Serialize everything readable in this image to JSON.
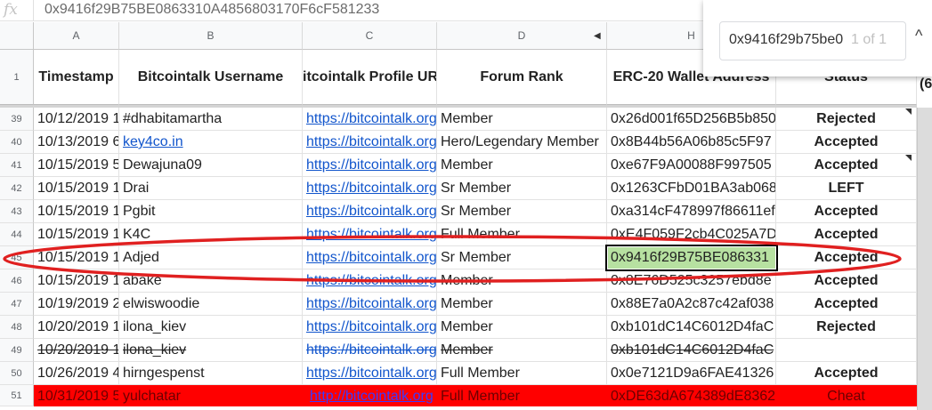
{
  "formula_bar": {
    "fx_label": "fx",
    "content": "0x9416f29B75BE0863310A4856803170F6cF581233"
  },
  "columns": [
    {
      "letter": "A"
    },
    {
      "letter": "B"
    },
    {
      "letter": "C"
    },
    {
      "letter": "D"
    },
    {
      "letter": "H"
    }
  ],
  "header_row": {
    "number": "1",
    "timestamp": "Timestamp",
    "username": "Bitcointalk Username",
    "profile_url": "itcointalk Profile UR",
    "forum_rank": "Forum Rank",
    "wallet": "ERC-20 Wallet Address",
    "status": "Status",
    "extra": "(6"
  },
  "rows": [
    {
      "num": "39",
      "ts": "10/12/2019 1",
      "user": "#dhabitamartha",
      "url": "https://bitcointalk.org",
      "rank": "Member",
      "wallet": "0x26d001f65D256B5b850",
      "status": "Rejected"
    },
    {
      "num": "40",
      "ts": "10/13/2019 6",
      "user": "key4co.in",
      "url": "https://bitcointalk.org",
      "rank": "Hero/Legendary Member",
      "wallet": "0x8B44b56A06b85c5F97",
      "status": "Accepted"
    },
    {
      "num": "41",
      "ts": "10/15/2019 5",
      "user": "Dewajuna09",
      "url": "https://bitcointalk.org",
      "rank": "Member",
      "wallet": "0xe67F9A00088F997505",
      "status": "Accepted"
    },
    {
      "num": "42",
      "ts": "10/15/2019 1",
      "user": "Drai",
      "url": "https://bitcointalk.org",
      "rank": "Sr Member",
      "wallet": "0x1263CFbD01BA3ab068",
      "status": "LEFT"
    },
    {
      "num": "43",
      "ts": "10/15/2019 1",
      "user": "Pgbit",
      "url": "https://bitcointalk.org",
      "rank": "Sr Member",
      "wallet": "0xa314cF478997f86611ef",
      "status": "Accepted"
    },
    {
      "num": "44",
      "ts": "10/15/2019 1",
      "user": "K4C",
      "url": "https://bitcointalk.org",
      "rank": "Full Member",
      "wallet": "0xE4F059F2cb4C025A7D",
      "status": "Accepted"
    },
    {
      "num": "45",
      "ts": "10/15/2019 1",
      "user": "Adjed",
      "url": "https://bitcointalk.org",
      "rank": "Sr Member",
      "wallet": "0x9416f29B75BE086331",
      "status": "Accepted"
    },
    {
      "num": "46",
      "ts": "10/15/2019 1",
      "user": "abake",
      "url": "https://bitcointalk.org",
      "rank": "Member",
      "wallet": "0x8E76D525c3257ebd8e",
      "status": "Accepted"
    },
    {
      "num": "47",
      "ts": "10/19/2019 2",
      "user": "elwiswoodie",
      "url": "https://bitcointalk.org",
      "rank": "Member",
      "wallet": "0x88E7a0A2c87c42af038",
      "status": "Accepted"
    },
    {
      "num": "48",
      "ts": "10/20/2019 1",
      "user": "ilona_kiev",
      "url": "https://bitcointalk.org",
      "rank": "Member",
      "wallet": "0xb101dC14C6012D4faC",
      "status": "Rejected"
    },
    {
      "num": "49",
      "ts": "10/20/2019 1",
      "user": "ilona_kiev",
      "url": "https://bitcointalk.org",
      "rank": "Member",
      "wallet": "0xb101dC14C6012D4faC",
      "status": ""
    },
    {
      "num": "50",
      "ts": "10/26/2019 4",
      "user": "hirngespenst",
      "url": "https://bitcointalk.org",
      "rank": "Full Member",
      "wallet": "0x0e7121D9a6FAE41326",
      "status": "Accepted"
    },
    {
      "num": "51",
      "ts": "10/31/2019 5",
      "user": "yulchatar",
      "url": "http://bitcointalk.org",
      "rank": "Full Member",
      "wallet": "0xDE63dA674389dE8362",
      "status": "Cheat"
    }
  ],
  "find": {
    "query": "0x9416f29b75be0",
    "count": "1 of 1",
    "arrow": "^"
  },
  "colors": {
    "highlight_red": "#ff0000",
    "selected_cell": "#b7e1a1",
    "annotation_ellipse": "#e02020"
  }
}
